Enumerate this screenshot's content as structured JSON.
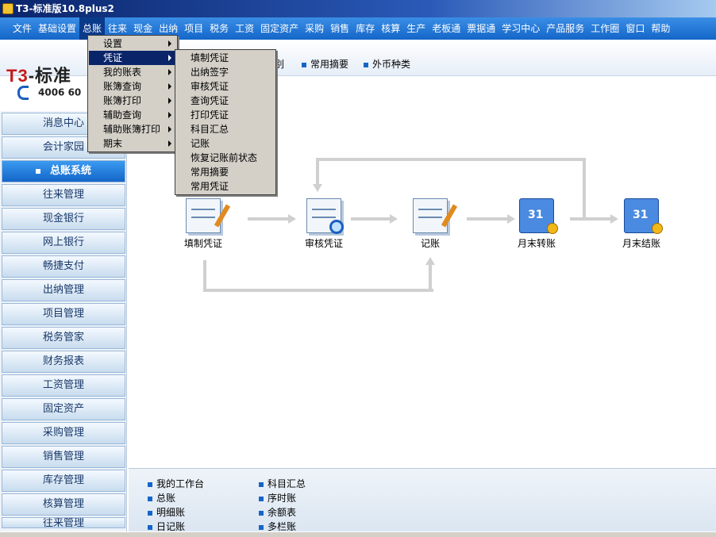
{
  "window": {
    "title": "T3-标准版10.8plus2"
  },
  "menubar": [
    "文件",
    "基础设置",
    "总账",
    "往来",
    "现金",
    "出纳",
    "项目",
    "税务",
    "工资",
    "固定资产",
    "采购",
    "销售",
    "库存",
    "核算",
    "生产",
    "老板通",
    "票据通",
    "学习中心",
    "产品服务",
    "工作圈",
    "窗口",
    "帮助"
  ],
  "header": {
    "logo_red": "T3",
    "logo_dark": "-标准",
    "phone": "4006 60",
    "quick_links": [
      "别",
      "常用摘要",
      "外币种类"
    ]
  },
  "sidebar": {
    "items": [
      "消息中心",
      "会计家园",
      "总账系统",
      "往来管理",
      "现金银行",
      "网上银行",
      "畅捷支付",
      "出纳管理",
      "项目管理",
      "税务管家",
      "财务报表",
      "工资管理",
      "固定资产",
      "采购管理",
      "销售管理",
      "库存管理",
      "核算管理",
      "往来管理"
    ],
    "selected": "总账系统"
  },
  "gl_menu": {
    "items": [
      "设置",
      "凭证",
      "我的账表",
      "账簿查询",
      "账簿打印",
      "辅助查询",
      "辅助账簿打印",
      "期末"
    ],
    "highlighted": "凭证"
  },
  "voucher_menu": {
    "items": [
      "填制凭证",
      "出纳签字",
      "审核凭证",
      "查询凭证",
      "打印凭证",
      "科目汇总",
      "记账",
      "恢复记账前状态",
      "常用摘要",
      "常用凭证"
    ]
  },
  "flow": {
    "nodes": [
      "填制凭证",
      "审核凭证",
      "记账",
      "月末转账",
      "月末结账"
    ],
    "calendar_number": "31"
  },
  "bottom_links": {
    "left": [
      "我的工作台",
      "总账",
      "明细账",
      "日记账"
    ],
    "right": [
      "科目汇总",
      "序时账",
      "余额表",
      "多栏账"
    ]
  }
}
